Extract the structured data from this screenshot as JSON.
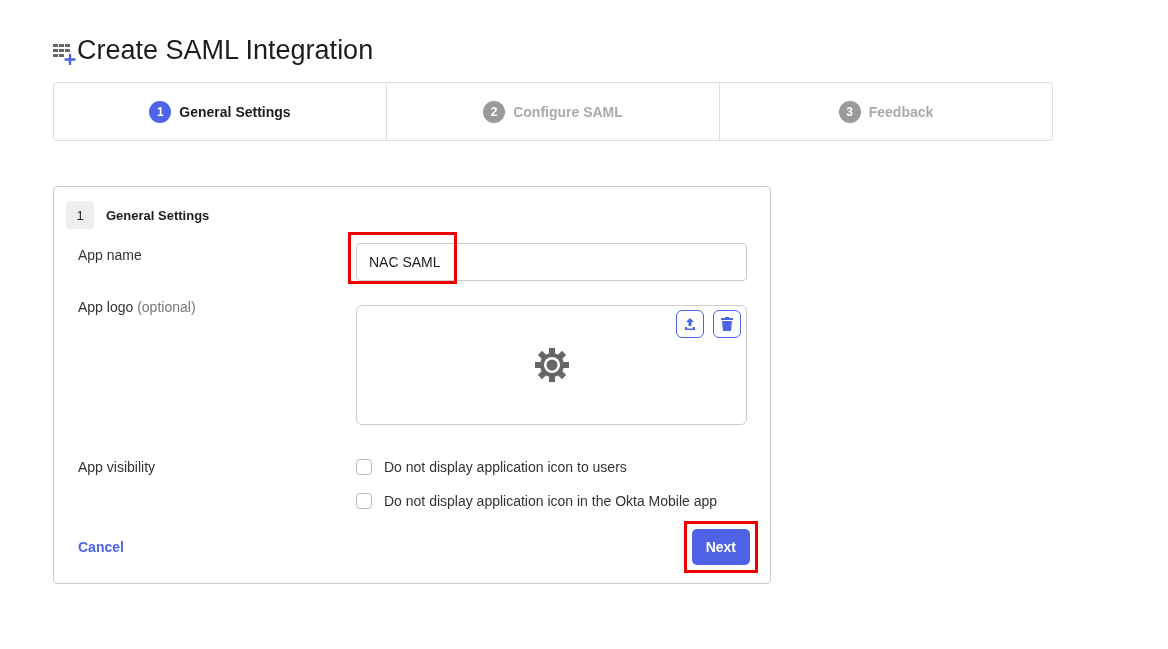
{
  "title": "Create SAML Integration",
  "steps": [
    {
      "number": "1",
      "label": "General Settings",
      "selected": true
    },
    {
      "number": "2",
      "label": "Configure SAML",
      "selected": false
    },
    {
      "number": "3",
      "label": "Feedback",
      "selected": false
    }
  ],
  "section": {
    "number": "1",
    "title": "General Settings"
  },
  "app_name": {
    "label": "App name",
    "value": "NAC SAML",
    "highlighted": true
  },
  "app_logo": {
    "label": "App logo",
    "hint": "(optional)"
  },
  "app_visibility": {
    "label": "App visibility",
    "options": [
      {
        "label": "Do not display application icon to users",
        "checked": false
      },
      {
        "label": "Do not display application icon in the Okta Mobile app",
        "checked": false
      }
    ]
  },
  "cancel": "Cancel",
  "next": {
    "label": "Next",
    "highlighted": true
  }
}
